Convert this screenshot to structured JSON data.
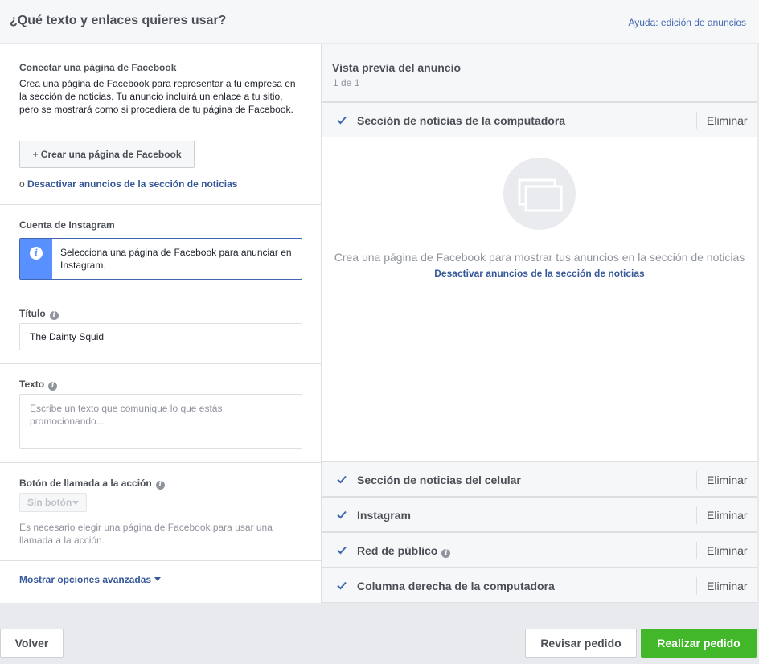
{
  "header": {
    "title": "¿Qué texto y enlaces quieres usar?",
    "help_link": "Ayuda: edición de anuncios"
  },
  "facebook_page": {
    "label": "Conectar una página de Facebook",
    "description": "Crea una página de Facebook para representar a tu empresa en la sección de noticias. Tu anuncio incluirá un enlace a tu sitio, pero se mostrará como si procediera de tu página de Facebook.",
    "create_button": "+ Crear una página de Facebook",
    "or_text": "o",
    "deactivate_link": "Desactivar anuncios de la sección de noticias"
  },
  "instagram": {
    "label": "Cuenta de Instagram",
    "notice": "Selecciona una página de Facebook para anunciar en Instagram."
  },
  "title_field": {
    "label": "Título",
    "value": "The Dainty Squid"
  },
  "text_field": {
    "label": "Texto",
    "placeholder": "Escribe un texto que comunique lo que estás promocionando..."
  },
  "cta": {
    "label": "Botón de llamada a la acción",
    "selected": "Sin botón",
    "note": "Es necesario elegir una página de Facebook para usar una llamada a la acción."
  },
  "advanced_link": "Mostrar opciones avanzadas",
  "preview": {
    "title": "Vista previa del anuncio",
    "count": "1 de 1",
    "placements": [
      {
        "label": "Sección de noticias de la computadora",
        "remove": "Eliminar"
      },
      {
        "label": "Sección de noticias del celular",
        "remove": "Eliminar"
      },
      {
        "label": "Instagram",
        "remove": "Eliminar"
      },
      {
        "label": "Red de público",
        "remove": "Eliminar"
      },
      {
        "label": "Columna derecha de la computadora",
        "remove": "Eliminar"
      }
    ],
    "empty_message": "Crea una página de Facebook para mostrar tus anuncios en la sección de noticias",
    "empty_link": "Desactivar anuncios de la sección de noticias"
  },
  "footer": {
    "back": "Volver",
    "review": "Revisar pedido",
    "place": "Realizar pedido"
  },
  "colors": {
    "accent": "#4267b2",
    "link": "#365899",
    "primary_button": "#42b72a",
    "info_bar": "#5890ff"
  }
}
